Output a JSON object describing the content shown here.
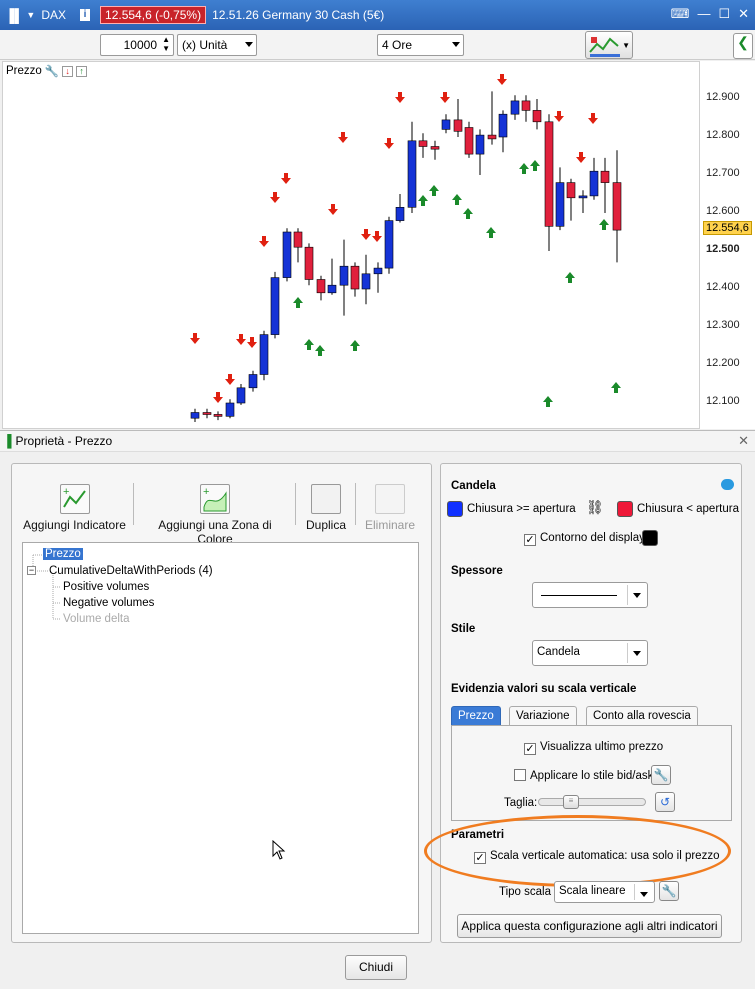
{
  "titlebar": {
    "symbol": "DAX",
    "price_badge": "12.554,6 (-0,75%)",
    "instrument": "12.51.26 Germany 30 Cash (5€)"
  },
  "toolbar": {
    "quantity": "10000",
    "unit": "(x) Unità",
    "timeframe": "4 Ore"
  },
  "chart": {
    "label": "Prezzo",
    "y_ticks": [
      "12.900",
      "12.800",
      "12.700",
      "12.600",
      "12.500",
      "12.400",
      "12.300",
      "12.200",
      "12.100"
    ],
    "last_price": "12.554,6",
    "colors": {
      "up": "#1533d6",
      "down": "#e0203c",
      "signal_up": "#1a8a2a",
      "signal_down": "#e02010"
    }
  },
  "chart_data": {
    "type": "candlestick",
    "ylim": [
      12060,
      12960
    ],
    "candles": [
      {
        "x": 192,
        "o": 12060,
        "c": 12075,
        "h": 12085,
        "l": 12050
      },
      {
        "x": 204,
        "o": 12075,
        "c": 12070,
        "h": 12085,
        "l": 12060
      },
      {
        "x": 215,
        "o": 12070,
        "c": 12065,
        "h": 12078,
        "l": 12055
      },
      {
        "x": 227,
        "o": 12065,
        "c": 12100,
        "h": 12110,
        "l": 12060
      },
      {
        "x": 238,
        "o": 12100,
        "c": 12140,
        "h": 12150,
        "l": 12095
      },
      {
        "x": 250,
        "o": 12140,
        "c": 12175,
        "h": 12185,
        "l": 12130
      },
      {
        "x": 261,
        "o": 12175,
        "c": 12280,
        "h": 12290,
        "l": 12160
      },
      {
        "x": 272,
        "o": 12280,
        "c": 12430,
        "h": 12445,
        "l": 12270
      },
      {
        "x": 284,
        "o": 12430,
        "c": 12550,
        "h": 12560,
        "l": 12420
      },
      {
        "x": 295,
        "o": 12550,
        "c": 12510,
        "h": 12560,
        "l": 12470
      },
      {
        "x": 306,
        "o": 12510,
        "c": 12425,
        "h": 12520,
        "l": 12410
      },
      {
        "x": 318,
        "o": 12425,
        "c": 12390,
        "h": 12435,
        "l": 12370
      },
      {
        "x": 329,
        "o": 12390,
        "c": 12410,
        "h": 12480,
        "l": 12385
      },
      {
        "x": 341,
        "o": 12410,
        "c": 12460,
        "h": 12530,
        "l": 12330
      },
      {
        "x": 352,
        "o": 12460,
        "c": 12400,
        "h": 12470,
        "l": 12380
      },
      {
        "x": 363,
        "o": 12400,
        "c": 12440,
        "h": 12490,
        "l": 12360
      },
      {
        "x": 375,
        "o": 12440,
        "c": 12455,
        "h": 12470,
        "l": 12390
      },
      {
        "x": 386,
        "o": 12455,
        "c": 12580,
        "h": 12590,
        "l": 12440
      },
      {
        "x": 397,
        "o": 12580,
        "c": 12615,
        "h": 12650,
        "l": 12575
      },
      {
        "x": 409,
        "o": 12615,
        "c": 12790,
        "h": 12840,
        "l": 12600
      },
      {
        "x": 420,
        "o": 12790,
        "c": 12775,
        "h": 12810,
        "l": 12745
      },
      {
        "x": 432,
        "o": 12775,
        "c": 12768,
        "h": 12790,
        "l": 12740
      },
      {
        "x": 443,
        "o": 12820,
        "c": 12845,
        "h": 12860,
        "l": 12810
      },
      {
        "x": 455,
        "o": 12845,
        "c": 12815,
        "h": 12900,
        "l": 12800
      },
      {
        "x": 466,
        "o": 12825,
        "c": 12755,
        "h": 12840,
        "l": 12745
      },
      {
        "x": 477,
        "o": 12755,
        "c": 12805,
        "h": 12820,
        "l": 12700
      },
      {
        "x": 489,
        "o": 12805,
        "c": 12795,
        "h": 12920,
        "l": 12780
      },
      {
        "x": 500,
        "o": 12800,
        "c": 12860,
        "h": 12870,
        "l": 12760
      },
      {
        "x": 512,
        "o": 12860,
        "c": 12895,
        "h": 12910,
        "l": 12845
      },
      {
        "x": 523,
        "o": 12895,
        "c": 12870,
        "h": 12910,
        "l": 12840
      },
      {
        "x": 534,
        "o": 12870,
        "c": 12840,
        "h": 12900,
        "l": 12820
      },
      {
        "x": 546,
        "o": 12840,
        "c": 12565,
        "h": 12860,
        "l": 12500
      },
      {
        "x": 557,
        "o": 12565,
        "c": 12680,
        "h": 12720,
        "l": 12555
      },
      {
        "x": 568,
        "o": 12680,
        "c": 12640,
        "h": 12690,
        "l": 12580
      },
      {
        "x": 580,
        "o": 12640,
        "c": 12645,
        "h": 12660,
        "l": 12600
      },
      {
        "x": 591,
        "o": 12645,
        "c": 12710,
        "h": 12745,
        "l": 12635
      },
      {
        "x": 602,
        "o": 12710,
        "c": 12680,
        "h": 12745,
        "l": 12600
      },
      {
        "x": 614,
        "o": 12680,
        "c": 12555,
        "h": 12765,
        "l": 12470
      }
    ]
  },
  "dialog": {
    "title": "Proprietà - Prezzo",
    "toolbar": {
      "add_indicator": "Aggiungi Indicatore",
      "add_zone": "Aggiungi una Zona di Colore",
      "duplicate": "Duplica",
      "delete": "Eliminare"
    },
    "tree": [
      "Prezzo",
      "CumulativeDeltaWithPeriods (4)",
      "Positive volumes",
      "Negative volumes",
      "Volume delta"
    ],
    "candela": {
      "title": "Candela",
      "up_label": "Chiusura >= apertura",
      "down_label": "Chiusura < apertura",
      "outline_label": "Contorno del display",
      "up_color": "#1030ff",
      "down_color": "#ee1838",
      "outline_color": "#000000"
    },
    "spessore": {
      "title": "Spessore"
    },
    "stile": {
      "title": "Stile",
      "value": "Candela"
    },
    "evidenzia": {
      "title": "Evidenzia valori su scala verticale",
      "tabs": [
        "Prezzo",
        "Variazione",
        "Conto alla rovescia"
      ],
      "show_last": "Visualizza ultimo prezzo",
      "bidask": "Applicare lo stile bid/ask",
      "size_label": "Taglia:"
    },
    "parametri": {
      "title": "Parametri",
      "auto_scale": "Scala verticale automatica: usa solo il prezzo",
      "scale_type_label": "Tipo scala",
      "scale_type_value": "Scala lineare"
    },
    "apply_button": "Applica questa configurazione agli altri indicatori",
    "close_button": "Chiudi"
  }
}
